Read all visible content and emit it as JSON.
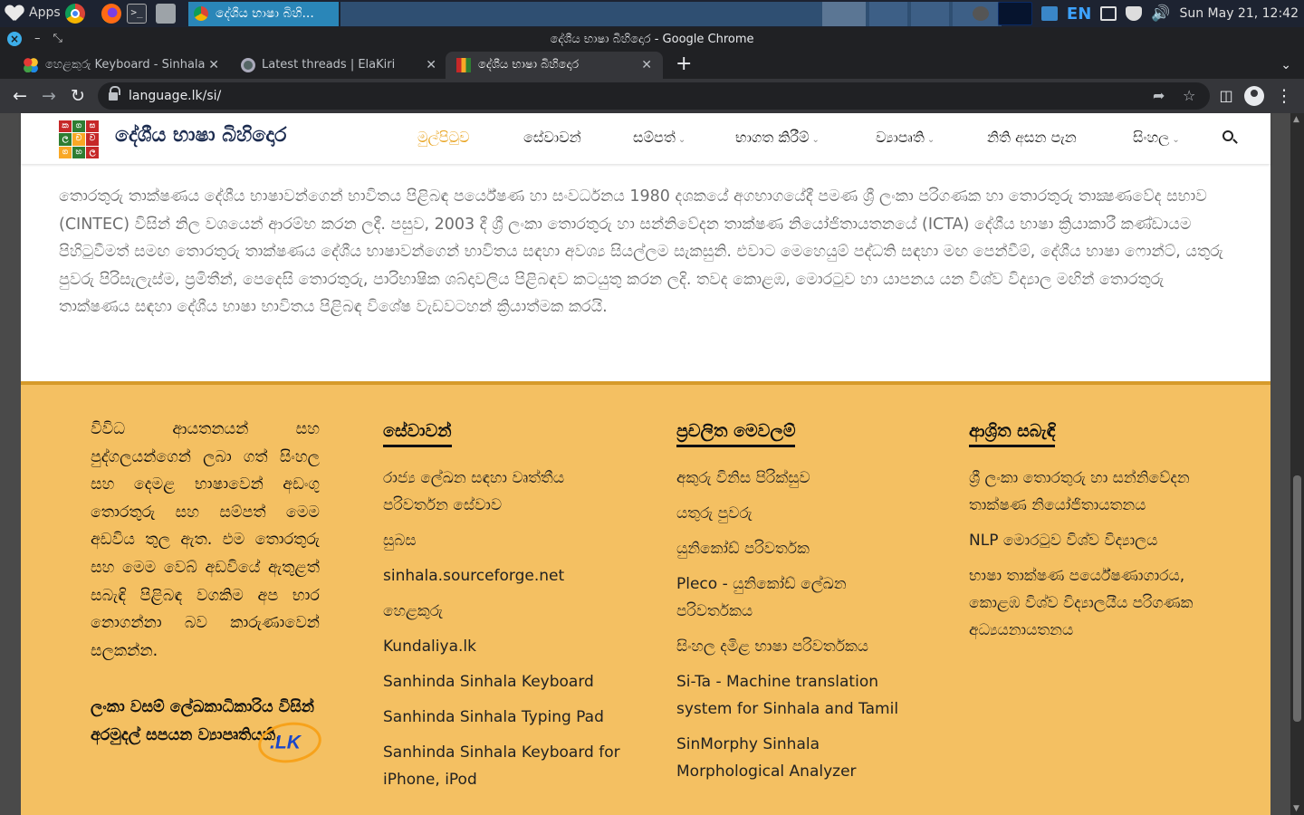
{
  "os": {
    "apps_label": "Apps",
    "active_task_title": "දේශීය භාෂා බිහි...",
    "keyboard_layout": "EN",
    "clock": "Sun May 21, 12:42"
  },
  "chrome": {
    "window_title": "දේශීය භාෂා බිහිදොර - Google Chrome",
    "tabs": [
      {
        "title": "හෙළකුරු Keyboard - Sinhala"
      },
      {
        "title": "Latest threads | ElaKiri"
      },
      {
        "title": "දේශීය භාෂා බිහිදොර"
      }
    ],
    "url": "language.lk/si/"
  },
  "site": {
    "logo_letters": [
      "ක",
      "ග",
      "ස",
      "ල",
      "ච",
      "ව",
      "ග",
      "හ",
      "ල"
    ],
    "name": "දේශීය භාෂා බිහිදොර",
    "nav": [
      {
        "label": "මුල්පිටුව"
      },
      {
        "label": "සේවාවන්"
      },
      {
        "label": "සම්පත්"
      },
      {
        "label": "භාගත කිරීම්"
      },
      {
        "label": "ව්‍යාපෘති"
      },
      {
        "label": "නිති අසන පැන"
      },
      {
        "label": "සිංහල"
      }
    ],
    "intro": "තොරතුරු තාක්ෂණය දේශීය භාෂාවන්ගෙන් භාවිතය පිළිබඳ පර්යේෂණ හා සංවර්ධනය 1980 දශකයේ අගභාගයේදී පමණ ශ්‍රී ලංකා පරිගණක හා තොරතුරු තාක්‍ෂණවේද සභාව (CINTEC) විසින් නිල වශයෙන් ආරම්භ කරන ලදී. පසුව, 2003 දී ශ්‍රී ලංකා තොරතුරු හා සන්නිවේදන තාක්ෂණ නියෝජිතායතනයේ (ICTA) දේශීය භාෂා ක්‍රියාකාරී කණ්ඩායම පිහිටුවීමත් සමඟ තොරතුරු තාක්ෂණය දේශීය භාෂාවන්ගෙන් භාවිතය සඳහා අවශ්‍ය සියල්ලම සැකසුනි. එවාට මෙහෙයුම් පද්ධති සඳහා මඟ පෙන්වීම්, දේශීය භාෂා ෆොන්ට්, යතුරු පුවරු පිරිසැලැස්ම, ප්‍රමිතීන්, පෙදෙසි තොරතුරු, පාරිභාෂික ශබ්දාවලිය පිළිබඳව කටයුතු කරන ලදි. තවද කොළඹ, මොරටුව හා යාපනය යන විශ්ව විද්‍යාල මඟින් තොරතුරු තාක්ෂණය සඳහා දේශීය භාෂා භාවිතය පිළිබඳ විශේෂ වැඩවටහන් ක්‍රියාත්මක කරයි."
  },
  "footer": {
    "about": "විවිධ ආයතනයන් සහ පුද්ගලයන්ගෙන් ලබා ගත් සිංහල සහ දෙමළ භාෂාවෙන් අඩංගු තොරතුරු සහ සම්පත් මෙම අඩවිය තුල ඇත. එම තොරතුරු සහ මෙම වෙබ් අඩවියේ ඇතුළත් සබැඳි පිළිබඳ වගකිම අප භාර නොගන්නා බව කාරුණාවෙන් සලකන්න.",
    "funded_by": "ලංකා වසම් ලේඛකාධිකාරිය විසින් අරමුදල් සපයන ව්‍යාපෘතියකි.",
    "lk_logo_text": ".LK",
    "columns": [
      {
        "heading": "සේවාවන්",
        "links": [
          "රාජ්‍ය ලේඛන සඳහා වෘත්තීය පරිවර්තන සේවාව",
          "සුබස",
          "sinhala.sourceforge.net",
          "හෙළකුරු",
          "Kundaliya.lk",
          "Sanhinda Sinhala Keyboard",
          "Sanhinda Sinhala Typing Pad",
          "Sanhinda Sinhala Keyboard for iPhone, iPod"
        ]
      },
      {
        "heading": "ප්‍රචලිත මෙවලම්",
        "links": [
          "අකුරු විනිස පිරික්සුව",
          "යතුරු පුවරු",
          "යුනිකෝඩ් පරිවර්තක",
          "Pleco - යුනිකෝඩ් ලේඛන පරිවර්තකය",
          "සිංහල දමිළ භාෂා පරිවර්තකය",
          "Si-Ta - Machine translation system for Sinhala and Tamil",
          "SinMorphy Sinhala Morphological Analyzer"
        ]
      },
      {
        "heading": "ආශ්‍රිත සබැඳි",
        "links": [
          "ශ්‍රී ලංකා තොරතුරු හා සන්නිවේදන තාක්ෂණ නියෝජිතායතනය",
          "NLP මොරටුව විශ්ව විද්‍යාලය",
          "භාෂා තාක්ෂණ පර්යේෂණාගාරය, කොළඹ විශ්ව විද්‍යාලයීය පරිගණක අධ්‍යයනායතනය"
        ]
      }
    ]
  }
}
